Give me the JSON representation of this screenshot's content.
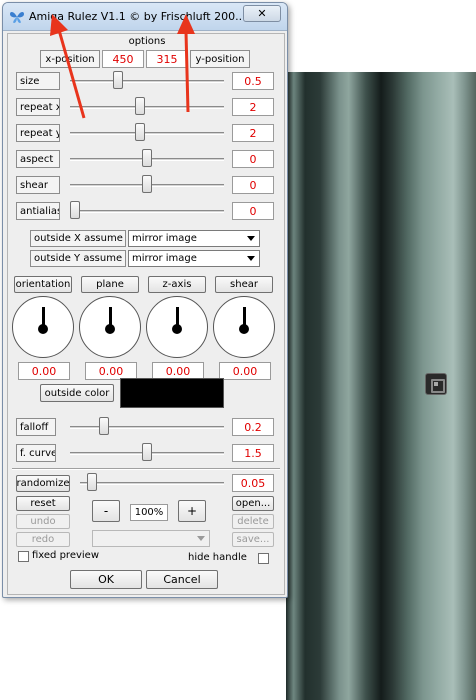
{
  "window": {
    "title": "Amiga Rulez V1.1 © by Frischluft 200...",
    "close_label": "✕"
  },
  "options_label": "options",
  "position": {
    "x_label": "x-position",
    "x_value": "450",
    "y_value": "315",
    "y_label": "y-position"
  },
  "sliders": [
    {
      "label": "size",
      "value": "0.5",
      "level": 0.3
    },
    {
      "label": "repeat x",
      "value": "2",
      "level": 0.45
    },
    {
      "label": "repeat y",
      "value": "2",
      "level": 0.45
    },
    {
      "label": "aspect",
      "value": "0",
      "level": 0.5
    },
    {
      "label": "shear",
      "value": "0",
      "level": 0.5
    },
    {
      "label": "antialias",
      "value": "0",
      "level": 0.0
    }
  ],
  "assume": [
    {
      "label": "outside X assume",
      "value": "mirror image"
    },
    {
      "label": "outside Y assume",
      "value": "mirror image"
    }
  ],
  "dials": [
    {
      "label": "orientation",
      "value": "0.00"
    },
    {
      "label": "plane",
      "value": "0.00"
    },
    {
      "label": "z-axis",
      "value": "0.00"
    },
    {
      "label": "shear",
      "value": "0.00"
    }
  ],
  "outside_color": {
    "label": "outside color",
    "color": "#000000"
  },
  "falloff": {
    "label": "falloff",
    "value": "0.2",
    "level": 0.2
  },
  "f_curve": {
    "label": "f. curve",
    "value": "1.5",
    "level": 0.5
  },
  "randomize": {
    "label": "randomize",
    "value": "0.05",
    "level": 0.05
  },
  "buttons": {
    "reset": "reset",
    "undo": "undo",
    "redo": "redo",
    "minus": "-",
    "plus": "+",
    "zoom": "100%",
    "open": "open...",
    "delete": "delete",
    "save": "save...",
    "ok": "OK",
    "cancel": "Cancel"
  },
  "fixed_preview_label": "fixed preview",
  "hide_handle_label": "hide handle",
  "colors": {
    "value_red": "#e00000",
    "arrow_red": "#e8341c"
  }
}
